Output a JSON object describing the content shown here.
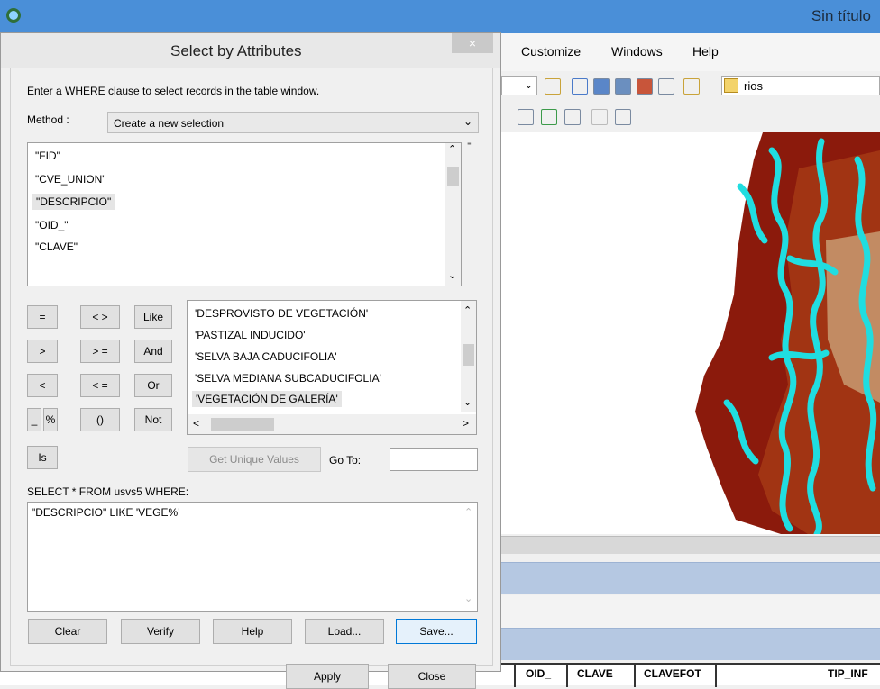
{
  "app": {
    "title": "Sin título"
  },
  "menu": [
    "Customize",
    "Windows",
    "Help"
  ],
  "toolbar": {
    "layer_dropdown": "rios"
  },
  "table_headers": [
    "OID_",
    "CLAVE",
    "CLAVEFOT",
    "TIP_INF"
  ],
  "dialog": {
    "title": "Select by Attributes",
    "close_label": "×",
    "instruction": "Enter a WHERE clause to select records in the table window.",
    "method_label": "Method :",
    "method_value": "Create a new selection",
    "fields": [
      "\"FID\"",
      "\"CVE_UNION\"",
      "\"DESCRIPCIO\"",
      "\"OID_\"",
      "\"CLAVE\""
    ],
    "selected_field": "\"DESCRIPCIO\"",
    "operators": {
      "eq": "=",
      "ne": "< >",
      "like": "Like",
      "gt": ">",
      "ge": "> =",
      "and": "And",
      "lt": "<",
      "le": "< =",
      "or": "Or",
      "underscore": "_",
      "percent": "%",
      "parens": "()",
      "not": "Not",
      "is": "Is"
    },
    "values": [
      "'DESPROVISTO DE VEGETACIÓN'",
      "'PASTIZAL INDUCIDO'",
      "'SELVA BAJA CADUCIFOLIA'",
      "'SELVA MEDIANA SUBCADUCIFOLIA'",
      "'VEGETACIÓN DE GALERÍA'"
    ],
    "selected_value": "'VEGETACIÓN DE GALERÍA'",
    "get_unique_values": "Get Unique Values",
    "goto_label": "Go To:",
    "goto_value": "",
    "select_from": "SELECT * FROM usvs5 WHERE:",
    "expression": "\"DESCRIPCIO\" LIKE 'VEGE%'",
    "buttons": {
      "clear": "Clear",
      "verify": "Verify",
      "help": "Help",
      "load": "Load...",
      "save": "Save..."
    },
    "apply": "Apply",
    "close": "Close"
  }
}
